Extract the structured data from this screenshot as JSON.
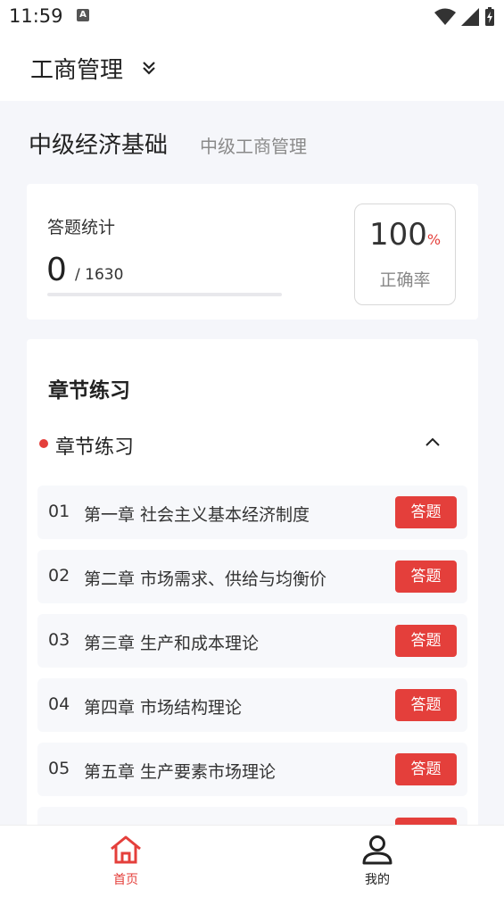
{
  "status_bar": {
    "time": "11:59",
    "notif_badge": "A"
  },
  "header": {
    "title": "工商管理"
  },
  "exam": {
    "title": "中级经济基础",
    "subtitle": "中级工商管理"
  },
  "stats": {
    "label": "答题统计",
    "count": "0",
    "total": "/ 1630",
    "progress_fraction": 0,
    "rate_value": "100",
    "rate_unit": "%",
    "rate_label": "正确率"
  },
  "chapters": {
    "heading": "章节练习",
    "section_label": "章节练习",
    "items": [
      {
        "num": "01",
        "name": "第一章 社会主义基本经济制度",
        "button": "答题"
      },
      {
        "num": "02",
        "name": "第二章 市场需求、供给与均衡价",
        "button": "答题"
      },
      {
        "num": "03",
        "name": "第三章 生产和成本理论",
        "button": "答题"
      },
      {
        "num": "04",
        "name": "第四章 市场结构理论",
        "button": "答题"
      },
      {
        "num": "05",
        "name": "第五章 生产要素市场理论",
        "button": "答题"
      }
    ]
  },
  "bottom_nav": {
    "home_label": "首页",
    "mine_label": "我的"
  },
  "colors": {
    "accent": "#e43f3b",
    "background": "#f5f6fa"
  }
}
